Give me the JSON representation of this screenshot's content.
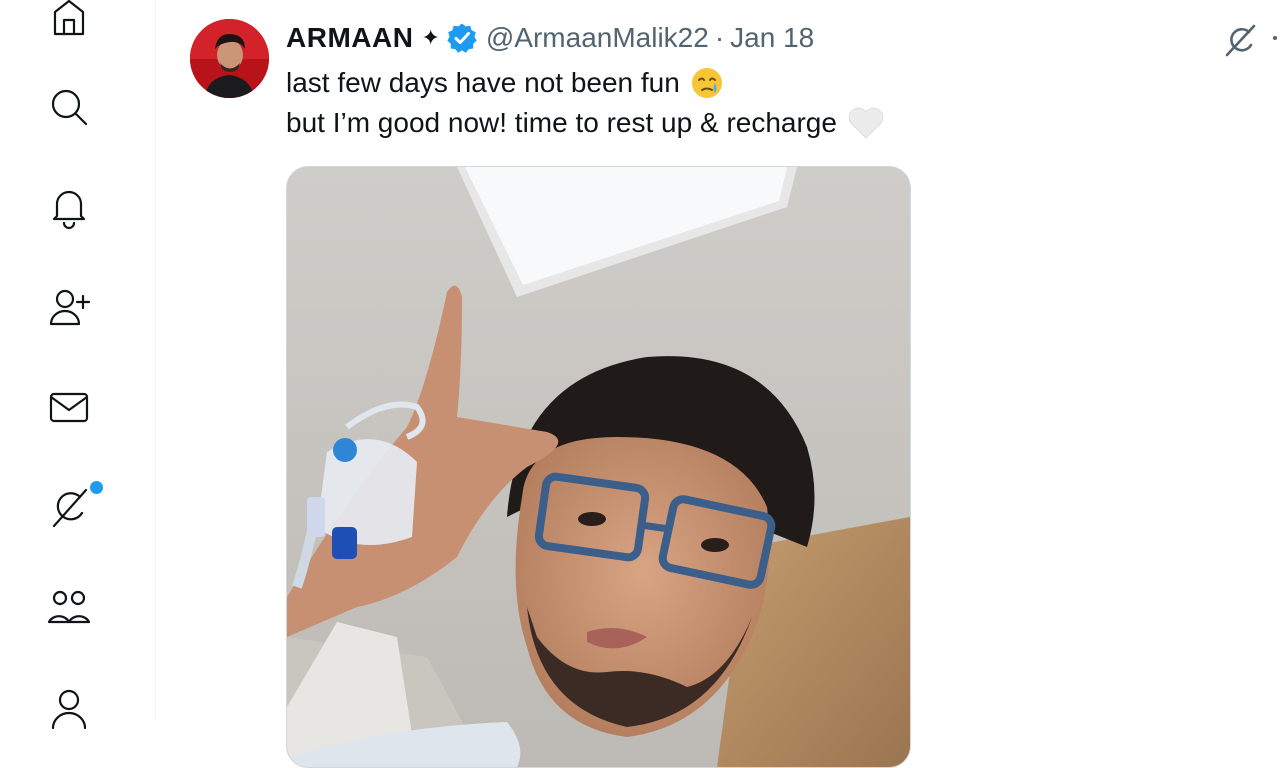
{
  "nav": {
    "items": [
      {
        "name": "home",
        "icon": "home-icon"
      },
      {
        "name": "explore",
        "icon": "search-icon"
      },
      {
        "name": "notifications",
        "icon": "bell-icon"
      },
      {
        "name": "follow",
        "icon": "add-user-icon"
      },
      {
        "name": "messages",
        "icon": "mail-icon"
      },
      {
        "name": "grok",
        "icon": "grok-icon"
      },
      {
        "name": "communities",
        "icon": "communities-icon"
      },
      {
        "name": "profile",
        "icon": "profile-icon"
      }
    ],
    "accent": "#1d9bf0"
  },
  "tweet": {
    "author_name": "ARMAAN",
    "sparkle": "✦",
    "handle": "@ArmaanMalik22",
    "separator": "·",
    "date": "Jan 18",
    "text_line1": "last few days have not been fun",
    "text_line2": "but I’m good now! time to rest up & recharge",
    "emoji_line1": "face-holding-back-tears",
    "emoji_line2": "white-heart",
    "verified_color": "#1d9bf0"
  }
}
